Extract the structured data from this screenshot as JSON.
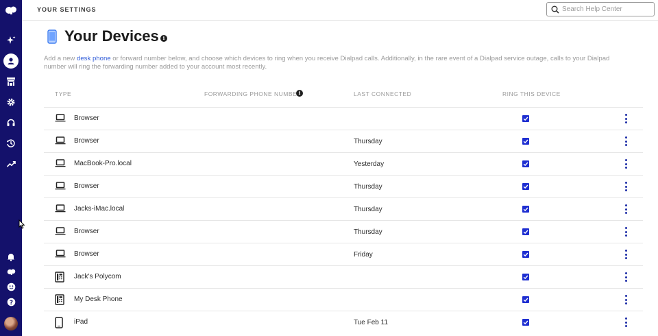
{
  "header": {
    "title": "YOUR SETTINGS",
    "search": {
      "placeholder": "Search Help Center",
      "value": ""
    }
  },
  "sidebar": {
    "top_items": [
      {
        "icon": "dialpad-logo-icon"
      },
      {
        "icon": "sparkle-icon"
      },
      {
        "icon": "user-icon",
        "active": true
      },
      {
        "icon": "office-icon"
      },
      {
        "icon": "gear-icon"
      },
      {
        "icon": "headset-icon"
      },
      {
        "icon": "history-icon"
      },
      {
        "icon": "analytics-icon"
      }
    ],
    "bottom_items": [
      {
        "icon": "bell-icon"
      },
      {
        "icon": "dialpad-logo-icon"
      },
      {
        "icon": "smiley-icon"
      },
      {
        "icon": "help-icon"
      },
      {
        "icon": "avatar"
      }
    ]
  },
  "page": {
    "title": "Your Devices",
    "description_pre": "Add a new ",
    "description_link": "desk phone",
    "description_post": " or forward number below, and choose which devices to ring when you receive Dialpad calls. Additionally, in the rare event of a Dialpad service outage, calls to your Dialpad number will ring the forwarding number added to your account most recently."
  },
  "table": {
    "columns": {
      "type": "TYPE",
      "forwarding": "FORWARDING PHONE NUMBER",
      "last": "LAST CONNECTED",
      "ring": "RING THIS DEVICE"
    },
    "rows": [
      {
        "icon": "laptop-icon",
        "name": "Browser",
        "last_connected": "",
        "ring": true
      },
      {
        "icon": "laptop-icon",
        "name": "Browser",
        "last_connected": "Thursday",
        "ring": true
      },
      {
        "icon": "laptop-icon",
        "name": "MacBook-Pro.local",
        "last_connected": "Yesterday",
        "ring": true
      },
      {
        "icon": "laptop-icon",
        "name": "Browser",
        "last_connected": "Thursday",
        "ring": true
      },
      {
        "icon": "laptop-icon",
        "name": "Jacks-iMac.local",
        "last_connected": "Thursday",
        "ring": true
      },
      {
        "icon": "laptop-icon",
        "name": "Browser",
        "last_connected": "Thursday",
        "ring": true
      },
      {
        "icon": "laptop-icon",
        "name": "Browser",
        "last_connected": "Friday",
        "ring": true
      },
      {
        "icon": "desk-phone-icon",
        "name": "Jack's Polycom",
        "last_connected": "",
        "ring": true
      },
      {
        "icon": "desk-phone-icon",
        "name": "My Desk Phone",
        "last_connected": "",
        "ring": true
      },
      {
        "icon": "tablet-icon",
        "name": "iPad",
        "last_connected": "Tue Feb 11",
        "ring": true
      }
    ]
  },
  "colors": {
    "sidebar": "#14116b",
    "accent": "#1f2fd1",
    "link": "#2f5bd8"
  }
}
